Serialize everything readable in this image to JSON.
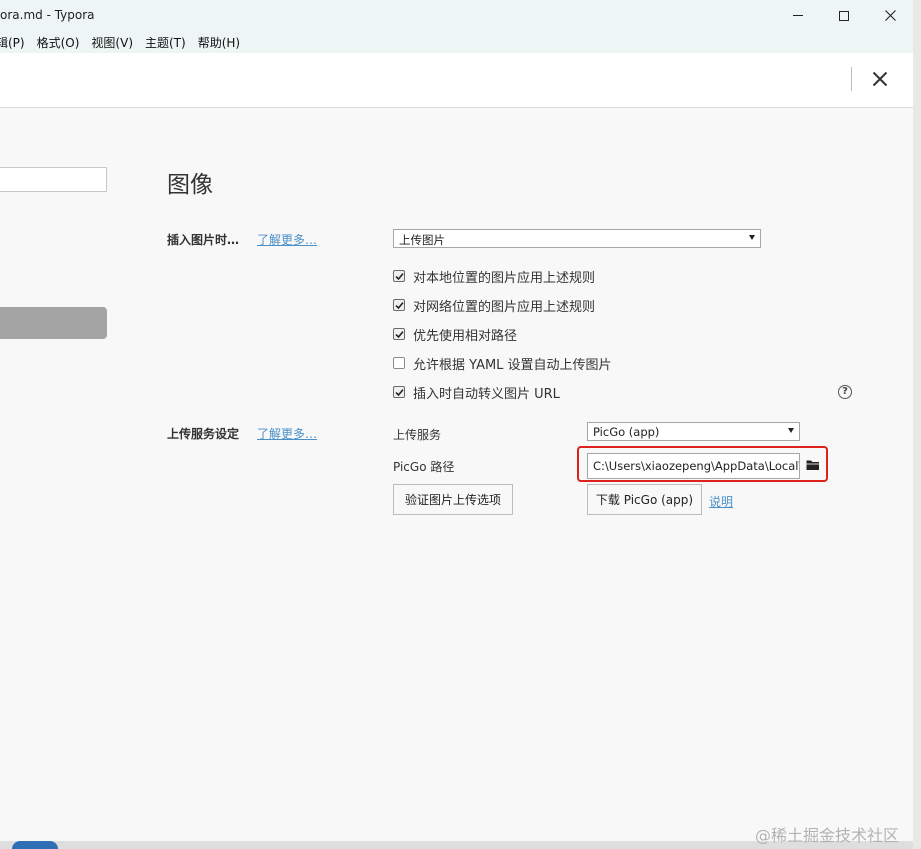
{
  "window": {
    "title": "ora.md - Typora"
  },
  "menubar": [
    "辑(P)",
    "格式(O)",
    "视图(V)",
    "主题(T)",
    "帮助(H)"
  ],
  "section": {
    "title": "图像"
  },
  "insert_image": {
    "label": "插入图片时…",
    "learn_more": "了解更多…",
    "selected": "上传图片",
    "options": [
      {
        "label": "对本地位置的图片应用上述规则",
        "checked": true
      },
      {
        "label": "对网络位置的图片应用上述规则",
        "checked": true
      },
      {
        "label": "优先使用相对路径",
        "checked": true
      },
      {
        "label": "允许根据 YAML 设置自动上传图片",
        "checked": false
      },
      {
        "label": "插入时自动转义图片 URL",
        "checked": true
      }
    ],
    "help": "?"
  },
  "upload_service": {
    "label": "上传服务设定",
    "learn_more": "了解更多…",
    "service_label": "上传服务",
    "service_selected": "PicGo (app)",
    "path_label": "PicGo 路径",
    "path_value": "C:\\Users\\xiaozepeng\\AppData\\Local\\Pr",
    "verify_button": "验证图片上传选项",
    "download_button": "下载 PicGo (app)",
    "instructions_link": "说明"
  },
  "watermark": "@稀土掘金技术社区",
  "colors": {
    "highlight": "#e0201a",
    "link": "#4a90c8",
    "sidebar_active": "#a4a4a4"
  }
}
